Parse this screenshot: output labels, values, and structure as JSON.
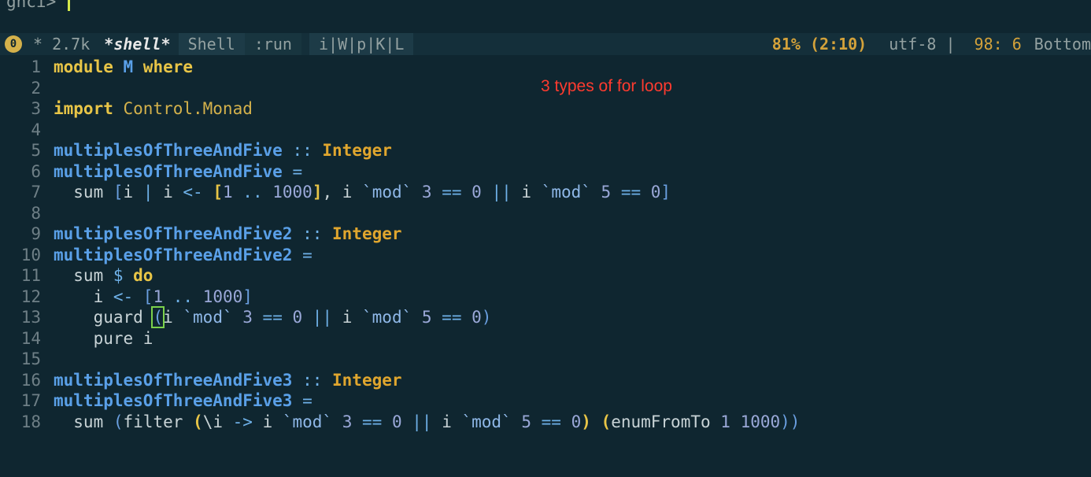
{
  "terminal": {
    "prompt": "ghci> "
  },
  "modeline": {
    "window_number": "0",
    "modified": "* 2.7k ",
    "buffer_name": "*shell*",
    "major_mode": "Shell",
    "process": ":run",
    "minor_modes": "i|W|p|K|L",
    "position": "81% (2:10)",
    "encoding": "utf-8 | ",
    "line_col": "98: 6",
    "scroll": "Bottom"
  },
  "annotation": "3 types of for loop",
  "lines": {
    "1": "1",
    "2": "2",
    "3": "3",
    "4": "4",
    "5": "5",
    "6": "6",
    "7": "7",
    "8": "8",
    "9": "9",
    "10": "10",
    "11": "11",
    "12": "12",
    "13": "13",
    "14": "14",
    "15": "15",
    "16": "16",
    "17": "17",
    "18": "18"
  },
  "code": {
    "l1_module": "module",
    "l1_name": " M ",
    "l1_where": "where",
    "l3_import": "import",
    "l3_mod": " Control.Monad",
    "l5_fn": "multiplesOfThreeAndFive",
    "l5_sig": " :: ",
    "l5_ty": "Integer",
    "l6_fn": "multiplesOfThreeAndFive",
    "l6_eq": " =",
    "l7_a": "  sum ",
    "l7_b": "[",
    "l7_c": "i ",
    "l7_d": "| ",
    "l7_e": "i ",
    "l7_f": "<- ",
    "l7_g": "[",
    "l7_h": "1",
    "l7_i": " .. ",
    "l7_j": "1000",
    "l7_k": "]",
    "l7_l": ", i ",
    "l7_m": "`mod`",
    "l7_n": " 3 ",
    "l7_o": "== ",
    "l7_p": "0",
    "l7_q": " || ",
    "l7_r": "i ",
    "l7_s": "`mod`",
    "l7_t": " 5 ",
    "l7_u": "== ",
    "l7_v": "0",
    "l7_w": "]",
    "l9_fn": "multiplesOfThreeAndFive2",
    "l9_sig": " :: ",
    "l9_ty": "Integer",
    "l10_fn": "multiplesOfThreeAndFive2",
    "l10_eq": " =",
    "l11_a": "  sum ",
    "l11_b": "$ ",
    "l11_c": "do",
    "l12_a": "    i ",
    "l12_b": "<- ",
    "l12_c": "[",
    "l12_d": "1",
    "l12_e": " .. ",
    "l12_f": "1000",
    "l12_g": "]",
    "l13_a": "    guard ",
    "l13_b": "(",
    "l13_c": "i ",
    "l13_d": "`mod`",
    "l13_e": " 3 ",
    "l13_f": "== ",
    "l13_g": "0",
    "l13_h": " || ",
    "l13_i": "i ",
    "l13_j": "`mod`",
    "l13_k": " 5 ",
    "l13_l": "== ",
    "l13_m": "0",
    "l13_n": ")",
    "l14": "    pure i",
    "l16_fn": "multiplesOfThreeAndFive3",
    "l16_sig": " :: ",
    "l16_ty": "Integer",
    "l17_fn": "multiplesOfThreeAndFive3",
    "l17_eq": " =",
    "l18_a": "  sum ",
    "l18_b": "(",
    "l18_c": "filter ",
    "l18_d": "(",
    "l18_e": "\\i ",
    "l18_f": "-> ",
    "l18_g": "i ",
    "l18_h": "`mod`",
    "l18_i": " 3 ",
    "l18_j": "== ",
    "l18_k": "0",
    "l18_l": " || ",
    "l18_m": "i ",
    "l18_n": "`mod`",
    "l18_o": " 5 ",
    "l18_p": "== ",
    "l18_q": "0",
    "l18_r": ") ",
    "l18_s": "(",
    "l18_t": "enumFromTo ",
    "l18_u": "1",
    "l18_v": " ",
    "l18_w": "1000",
    "l18_x": "))"
  }
}
